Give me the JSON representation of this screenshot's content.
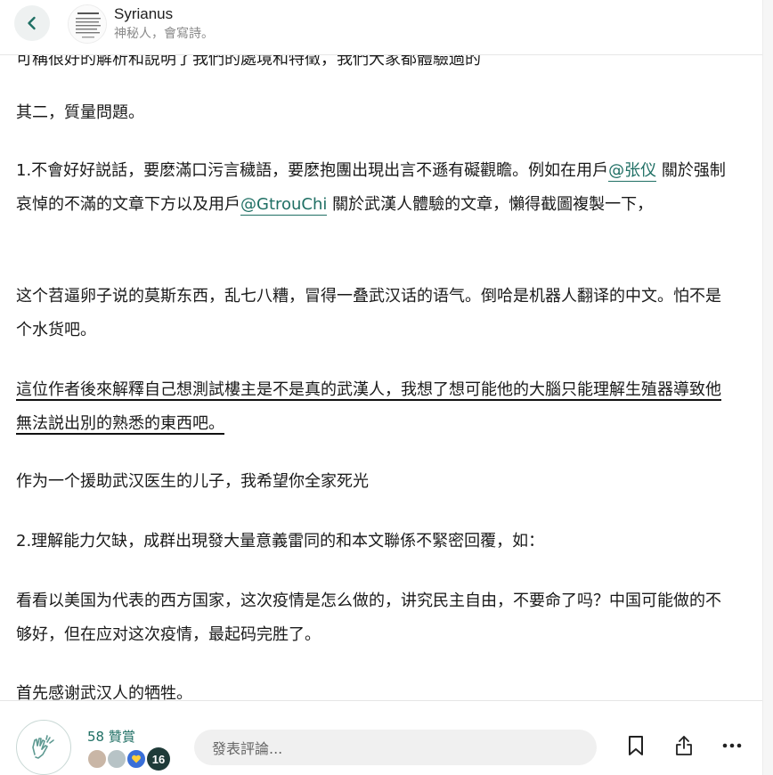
{
  "header": {
    "author_name": "Syrianus",
    "author_tagline": "神秘人，會寫詩。"
  },
  "article": {
    "cut_line": "可稱很好的解析和說明了我們的處境和特徵，我們大家都體驗過的",
    "p1": "其二，質量問題。",
    "p2_a": "1.不會好好説話，要麽滿口污言穢語，要麽抱團出現出言不遜有礙觀瞻。例如在用戶",
    "p2_mention1": "@张仪",
    "p2_b": " 關於强制哀悼的不滿的文章下方以及用戶",
    "p2_mention2": "@GtrouChi",
    "p2_c": " 關於武漢人體驗的文章，懶得截圖複製一下，",
    "p3": "这个苕逼卵子说的莫斯东西，乱七八糟，冒得一叠武汉话的语气。倒哈是机器人翻译的中文。怕不是个水货吧。",
    "p4": "這位作者後來解釋自己想測試樓主是不是真的武漢人，我想了想可能他的大腦只能理解生殖器導致他無法説出別的熟悉的東西吧。",
    "p5": "作为一个援助武汉医生的儿子，我希望你全家死光",
    "p6": "2.理解能力欠缺，成群出現發大量意義雷同的和本文聯係不緊密回覆，如：",
    "p7": "看看以美国为代表的西方国家，这次疫情是怎么做的，讲究民主自由，不要命了吗？中国可能做的不够好，但在应对这次疫情，最起码完胜了。",
    "p8": "首先感谢武汉人的牺牲。"
  },
  "footer": {
    "clap_count": "58 贊賞",
    "supporter_count": "16",
    "comment_placeholder": "發表評論..."
  },
  "colors": {
    "accent": "#1f6f64",
    "badge_dark": "#1f3b39"
  },
  "icons": [
    "back-arrow-icon",
    "clap-hands-icon",
    "bookmark-icon",
    "share-icon",
    "more-icon"
  ]
}
